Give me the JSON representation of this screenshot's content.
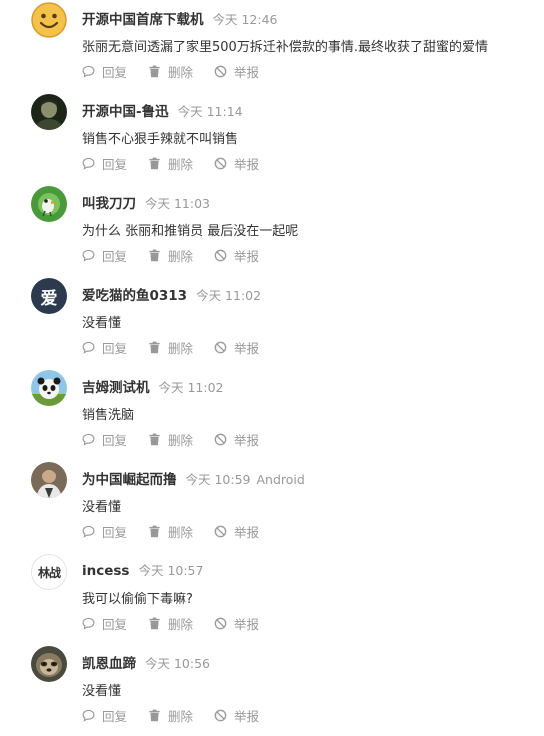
{
  "actions": {
    "reply": "回复",
    "delete": "删除",
    "report": "举报"
  },
  "comments": [
    {
      "name": "开源中国首席下载机",
      "time": "今天 12:46",
      "device": "",
      "text": "张丽无意间透漏了家里500万拆迁补偿款的事情.最终收获了甜蜜的爱情",
      "avatar": "smiley-icon"
    },
    {
      "name": "开源中国-鲁迅",
      "time": "今天 11:14",
      "device": "",
      "text": "销售不心狠手辣就不叫销售",
      "avatar": "photo-icon"
    },
    {
      "name": "叫我刀刀",
      "time": "今天 11:03",
      "device": "",
      "text": "为什么 张丽和推销员 最后没在一起呢",
      "avatar": "bird-icon"
    },
    {
      "name": "爱吃猫的鱼0313",
      "time": "今天 11:02",
      "device": "",
      "text": "没看懂",
      "avatar": "letter-avatar",
      "avatar_text": "爱"
    },
    {
      "name": "吉姆测试机",
      "time": "今天 11:02",
      "device": "",
      "text": "销售洗脑",
      "avatar": "panda-icon"
    },
    {
      "name": "为中国崛起而撸",
      "time": "今天 10:59",
      "device": "Android",
      "text": "没看懂",
      "avatar": "photo-icon"
    },
    {
      "name": "incess",
      "time": "今天 10:57",
      "device": "",
      "text": "我可以偷偷下毒嘛?",
      "avatar": "calligraphy-avatar",
      "avatar_text": "林战"
    },
    {
      "name": "凯恩血蹄",
      "time": "今天 10:56",
      "device": "",
      "text": "没看懂",
      "avatar": "sloth-icon"
    }
  ]
}
